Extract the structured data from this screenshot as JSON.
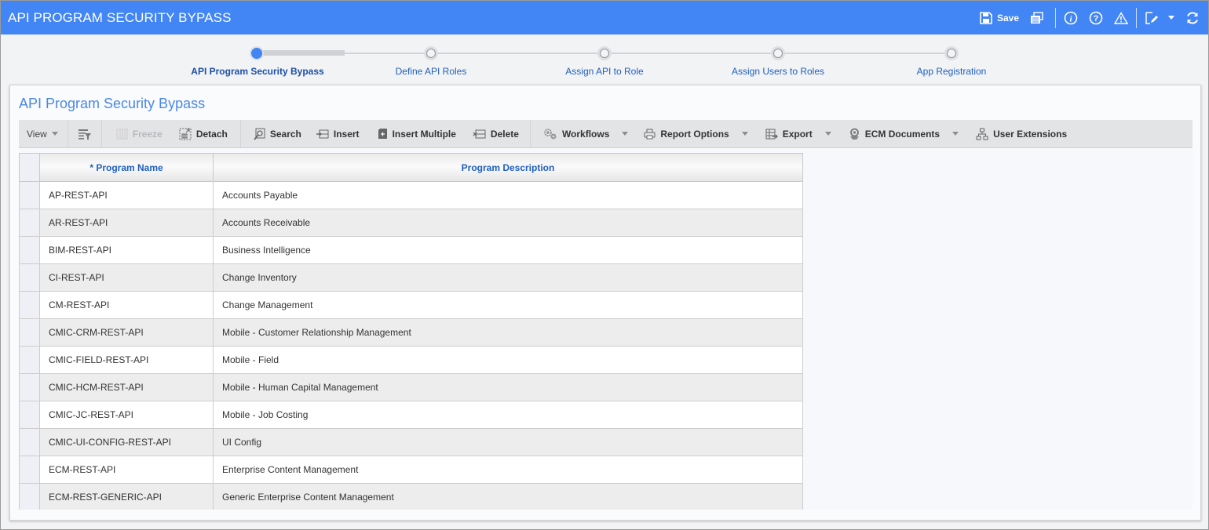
{
  "window": {
    "title": "API PROGRAM SECURITY BYPASS",
    "actions": {
      "save_label": "Save"
    }
  },
  "train": {
    "stops": [
      {
        "label": "API Program Security Bypass",
        "active": true
      },
      {
        "label": "Define API Roles",
        "active": false
      },
      {
        "label": "Assign API to Role",
        "active": false
      },
      {
        "label": "Assign Users to Roles",
        "active": false
      },
      {
        "label": "App Registration",
        "active": false
      }
    ]
  },
  "panel": {
    "title": "API Program Security Bypass"
  },
  "toolbar": {
    "view": "View",
    "freeze": "Freeze",
    "detach": "Detach",
    "search": "Search",
    "insert": "Insert",
    "insert_multiple": "Insert Multiple",
    "delete": "Delete",
    "workflows": "Workflows",
    "report_options": "Report Options",
    "export": "Export",
    "ecm_documents": "ECM Documents",
    "user_extensions": "User Extensions"
  },
  "grid": {
    "columns": [
      "* Program Name",
      "Program Description"
    ],
    "rows": [
      {
        "name": "AP-REST-API",
        "desc": "Accounts Payable"
      },
      {
        "name": "AR-REST-API",
        "desc": "Accounts Receivable"
      },
      {
        "name": "BIM-REST-API",
        "desc": "Business Intelligence"
      },
      {
        "name": "CI-REST-API",
        "desc": "Change Inventory"
      },
      {
        "name": "CM-REST-API",
        "desc": "Change Management"
      },
      {
        "name": "CMIC-CRM-REST-API",
        "desc": "Mobile - Customer Relationship Management"
      },
      {
        "name": "CMIC-FIELD-REST-API",
        "desc": "Mobile - Field"
      },
      {
        "name": "CMIC-HCM-REST-API",
        "desc": "Mobile - Human Capital Management"
      },
      {
        "name": "CMIC-JC-REST-API",
        "desc": "Mobile - Job Costing"
      },
      {
        "name": "CMIC-UI-CONFIG-REST-API",
        "desc": "UI Config"
      },
      {
        "name": "ECM-REST-API",
        "desc": "Enterprise Content Management"
      },
      {
        "name": "ECM-REST-GENERIC-API",
        "desc": "Generic Enterprise Content Management"
      }
    ]
  }
}
